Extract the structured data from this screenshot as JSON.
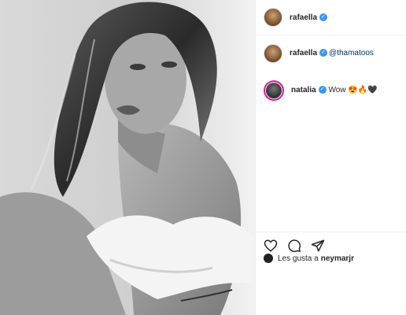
{
  "post": {
    "author": "rafaella",
    "caption_mention": "@thamatoos",
    "comments": [
      {
        "user": "natalia",
        "text": "Wow 😍🔥🖤"
      }
    ],
    "likes_prefix": "Les gusta a",
    "likes_user": "neymarjr"
  },
  "icons": {
    "like": "heart-icon",
    "comment": "comment-bubble-icon",
    "share": "share-arrow-icon",
    "verified": "verified-badge-icon"
  },
  "colors": {
    "verified_blue": "#3897f0",
    "mention_blue": "#003569",
    "story_ring": "#d6249f"
  }
}
